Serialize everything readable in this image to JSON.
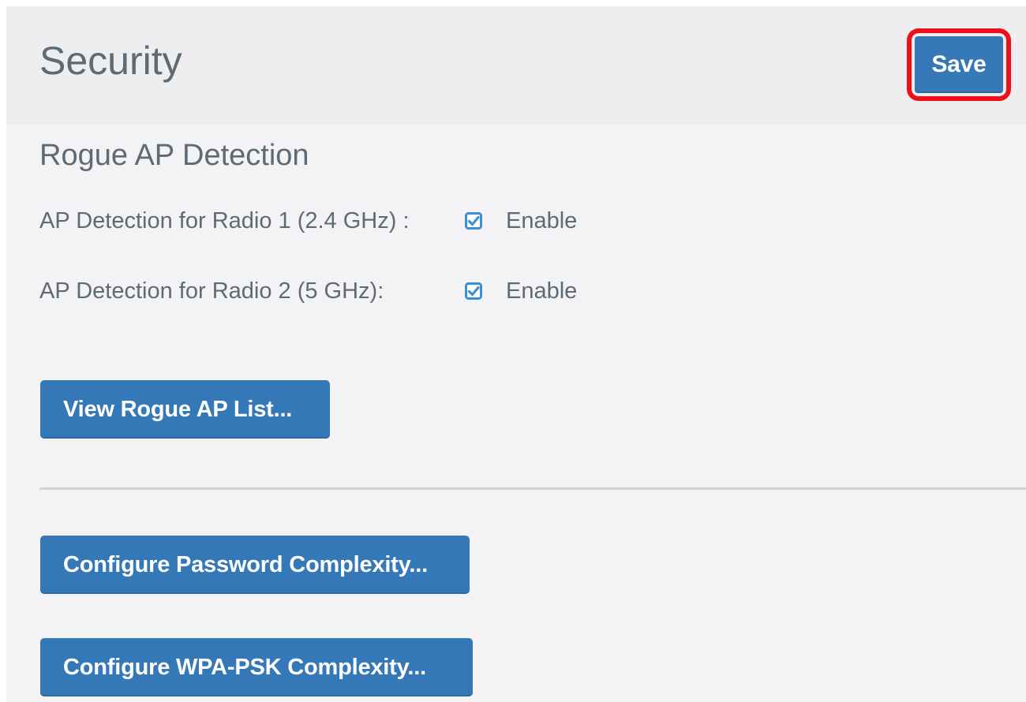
{
  "header": {
    "title": "Security",
    "save_label": "Save"
  },
  "rogue_ap": {
    "section_title": "Rogue AP Detection",
    "radio1": {
      "label": "AP Detection for Radio 1 (2.4 GHz) :",
      "checked": true,
      "option_label": "Enable"
    },
    "radio2": {
      "label": "AP Detection for Radio 2 (5 GHz):",
      "checked": true,
      "option_label": "Enable"
    },
    "view_list_label": "View Rogue AP List..."
  },
  "complexity": {
    "password_label": "Configure Password Complexity...",
    "wpa_psk_label": "Configure WPA-PSK Complexity..."
  },
  "colors": {
    "accent": "#3578b7",
    "highlight": "#ef0e1a",
    "checkbox": "#3b8fd6",
    "text": "#5e6a74"
  },
  "icons": {
    "checkbox_checked": "checkbox-checked-icon"
  }
}
